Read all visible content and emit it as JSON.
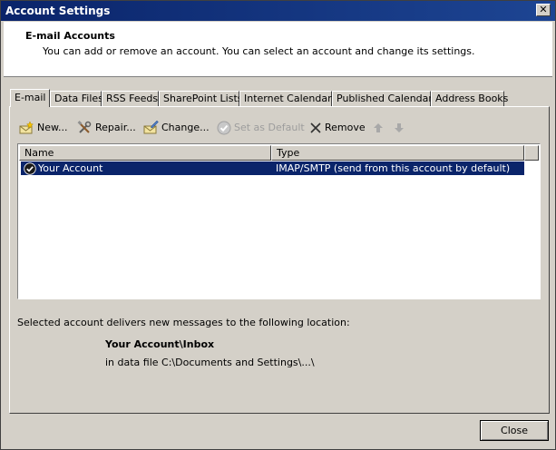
{
  "window": {
    "title": "Account Settings",
    "close_glyph": "✕"
  },
  "header": {
    "title": "E-mail Accounts",
    "description": "You can add or remove an account. You can select an account and change its settings."
  },
  "tabs": [
    {
      "label": "E-mail",
      "active": true
    },
    {
      "label": "Data Files",
      "active": false
    },
    {
      "label": "RSS Feeds",
      "active": false
    },
    {
      "label": "SharePoint Lists",
      "active": false
    },
    {
      "label": "Internet Calendars",
      "active": false
    },
    {
      "label": "Published Calendars",
      "active": false
    },
    {
      "label": "Address Books",
      "active": false
    }
  ],
  "toolbar": {
    "new_label": "New...",
    "repair_label": "Repair...",
    "change_label": "Change...",
    "set_default_label": "Set as Default",
    "remove_label": "Remove"
  },
  "list": {
    "columns": [
      "Name",
      "Type"
    ],
    "rows": [
      {
        "name": "Your Account",
        "type": "IMAP/SMTP (send from this account by default)",
        "selected": true
      }
    ]
  },
  "details": {
    "status": "Selected account delivers new messages to the following location:",
    "location": "Your Account\\Inbox",
    "data_file": "in data file C:\\Documents and Settings\\...\\"
  },
  "footer": {
    "close_label": "Close"
  },
  "colors": {
    "selection": "#0a246a",
    "title_bar": "#0a246a",
    "face": "#d4d0c8"
  }
}
